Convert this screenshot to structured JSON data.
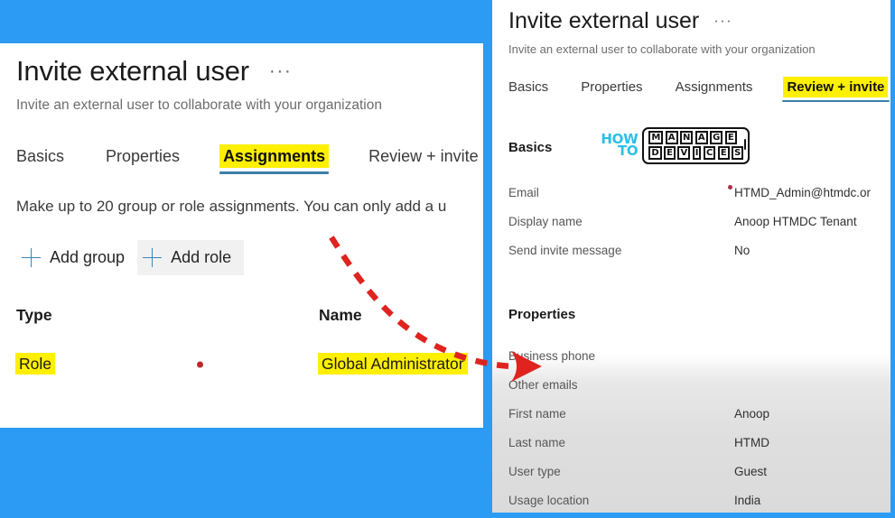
{
  "background": {
    "color": "#2b9bf4"
  },
  "accents": {
    "highlight_yellow": "#ffef00",
    "tab_underline": "#3b7fa8",
    "arrow_red": "#e0231f",
    "logo_cyan": "#2bbfe8"
  },
  "left_panel": {
    "title": "Invite external user",
    "overflow_menu": "···",
    "subtitle": "Invite an external user to collaborate with your organization",
    "tabs": [
      {
        "label": "Basics",
        "active": false,
        "highlighted": false
      },
      {
        "label": "Properties",
        "active": false,
        "highlighted": false
      },
      {
        "label": "Assignments",
        "active": true,
        "highlighted": true
      },
      {
        "label": "Review + invite",
        "active": false,
        "highlighted": false
      }
    ],
    "helper_text": "Make up to 20 group or role assignments. You can only add a u",
    "commands": [
      {
        "label": "Add group",
        "icon": "plus-icon",
        "hover": false
      },
      {
        "label": "Add role",
        "icon": "plus-icon",
        "hover": true
      }
    ],
    "table": {
      "headers": [
        "Type",
        "",
        "Name"
      ],
      "rows": [
        {
          "type": "Role",
          "marker": "red-dot",
          "name": "Global Administrator"
        }
      ]
    }
  },
  "right_panel": {
    "title": "Invite external user",
    "overflow_menu": "···",
    "subtitle": "Invite an external user to collaborate with your organization",
    "tabs": [
      {
        "label": "Basics",
        "active": false,
        "highlighted": false
      },
      {
        "label": "Properties",
        "active": false,
        "highlighted": false
      },
      {
        "label": "Assignments",
        "active": false,
        "highlighted": false
      },
      {
        "label": "Review + invite",
        "active": true,
        "highlighted": true
      }
    ],
    "basics": {
      "heading": "Basics",
      "fields": [
        {
          "key": "Email",
          "value": "HTMD_Admin@htmdc.or"
        },
        {
          "key": "Display name",
          "value": "Anoop HTMDC Tenant"
        },
        {
          "key": "Send invite message",
          "value": "No"
        }
      ]
    },
    "properties": {
      "heading": "Properties",
      "fields": [
        {
          "key": "Business phone",
          "value": ""
        },
        {
          "key": "Other emails",
          "value": ""
        },
        {
          "key": "First name",
          "value": "Anoop"
        },
        {
          "key": "Last name",
          "value": "HTMD"
        },
        {
          "key": "User type",
          "value": "Guest"
        },
        {
          "key": "Usage location",
          "value": "India"
        }
      ]
    },
    "logo": {
      "word_how": "HOW",
      "word_to": "TO",
      "line_manage": [
        "M",
        "A",
        "N",
        "A",
        "G",
        "E"
      ],
      "line_devices": [
        "D",
        "E",
        "V",
        "I",
        "C",
        "E",
        "S"
      ]
    }
  },
  "annotation": {
    "arrow": "red-dashed-curved-arrow",
    "from": "left-panel-assignments-area",
    "to": "right-panel-properties-section"
  }
}
